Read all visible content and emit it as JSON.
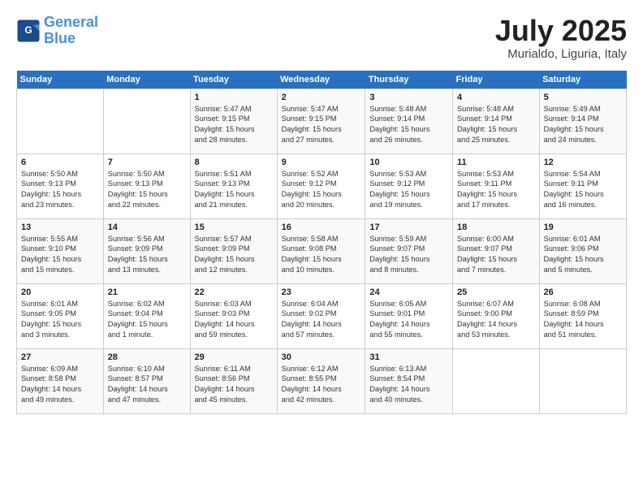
{
  "header": {
    "logo_line1": "General",
    "logo_line2": "Blue",
    "month": "July 2025",
    "location": "Murialdo, Liguria, Italy"
  },
  "weekdays": [
    "Sunday",
    "Monday",
    "Tuesday",
    "Wednesday",
    "Thursday",
    "Friday",
    "Saturday"
  ],
  "weeks": [
    [
      {
        "day": "",
        "info": ""
      },
      {
        "day": "",
        "info": ""
      },
      {
        "day": "1",
        "info": "Sunrise: 5:47 AM\nSunset: 9:15 PM\nDaylight: 15 hours\nand 28 minutes."
      },
      {
        "day": "2",
        "info": "Sunrise: 5:47 AM\nSunset: 9:15 PM\nDaylight: 15 hours\nand 27 minutes."
      },
      {
        "day": "3",
        "info": "Sunrise: 5:48 AM\nSunset: 9:14 PM\nDaylight: 15 hours\nand 26 minutes."
      },
      {
        "day": "4",
        "info": "Sunrise: 5:48 AM\nSunset: 9:14 PM\nDaylight: 15 hours\nand 25 minutes."
      },
      {
        "day": "5",
        "info": "Sunrise: 5:49 AM\nSunset: 9:14 PM\nDaylight: 15 hours\nand 24 minutes."
      }
    ],
    [
      {
        "day": "6",
        "info": "Sunrise: 5:50 AM\nSunset: 9:13 PM\nDaylight: 15 hours\nand 23 minutes."
      },
      {
        "day": "7",
        "info": "Sunrise: 5:50 AM\nSunset: 9:13 PM\nDaylight: 15 hours\nand 22 minutes."
      },
      {
        "day": "8",
        "info": "Sunrise: 5:51 AM\nSunset: 9:13 PM\nDaylight: 15 hours\nand 21 minutes."
      },
      {
        "day": "9",
        "info": "Sunrise: 5:52 AM\nSunset: 9:12 PM\nDaylight: 15 hours\nand 20 minutes."
      },
      {
        "day": "10",
        "info": "Sunrise: 5:53 AM\nSunset: 9:12 PM\nDaylight: 15 hours\nand 19 minutes."
      },
      {
        "day": "11",
        "info": "Sunrise: 5:53 AM\nSunset: 9:11 PM\nDaylight: 15 hours\nand 17 minutes."
      },
      {
        "day": "12",
        "info": "Sunrise: 5:54 AM\nSunset: 9:11 PM\nDaylight: 15 hours\nand 16 minutes."
      }
    ],
    [
      {
        "day": "13",
        "info": "Sunrise: 5:55 AM\nSunset: 9:10 PM\nDaylight: 15 hours\nand 15 minutes."
      },
      {
        "day": "14",
        "info": "Sunrise: 5:56 AM\nSunset: 9:09 PM\nDaylight: 15 hours\nand 13 minutes."
      },
      {
        "day": "15",
        "info": "Sunrise: 5:57 AM\nSunset: 9:09 PM\nDaylight: 15 hours\nand 12 minutes."
      },
      {
        "day": "16",
        "info": "Sunrise: 5:58 AM\nSunset: 9:08 PM\nDaylight: 15 hours\nand 10 minutes."
      },
      {
        "day": "17",
        "info": "Sunrise: 5:59 AM\nSunset: 9:07 PM\nDaylight: 15 hours\nand 8 minutes."
      },
      {
        "day": "18",
        "info": "Sunrise: 6:00 AM\nSunset: 9:07 PM\nDaylight: 15 hours\nand 7 minutes."
      },
      {
        "day": "19",
        "info": "Sunrise: 6:01 AM\nSunset: 9:06 PM\nDaylight: 15 hours\nand 5 minutes."
      }
    ],
    [
      {
        "day": "20",
        "info": "Sunrise: 6:01 AM\nSunset: 9:05 PM\nDaylight: 15 hours\nand 3 minutes."
      },
      {
        "day": "21",
        "info": "Sunrise: 6:02 AM\nSunset: 9:04 PM\nDaylight: 15 hours\nand 1 minute."
      },
      {
        "day": "22",
        "info": "Sunrise: 6:03 AM\nSunset: 9:03 PM\nDaylight: 14 hours\nand 59 minutes."
      },
      {
        "day": "23",
        "info": "Sunrise: 6:04 AM\nSunset: 9:02 PM\nDaylight: 14 hours\nand 57 minutes."
      },
      {
        "day": "24",
        "info": "Sunrise: 6:05 AM\nSunset: 9:01 PM\nDaylight: 14 hours\nand 55 minutes."
      },
      {
        "day": "25",
        "info": "Sunrise: 6:07 AM\nSunset: 9:00 PM\nDaylight: 14 hours\nand 53 minutes."
      },
      {
        "day": "26",
        "info": "Sunrise: 6:08 AM\nSunset: 8:59 PM\nDaylight: 14 hours\nand 51 minutes."
      }
    ],
    [
      {
        "day": "27",
        "info": "Sunrise: 6:09 AM\nSunset: 8:58 PM\nDaylight: 14 hours\nand 49 minutes."
      },
      {
        "day": "28",
        "info": "Sunrise: 6:10 AM\nSunset: 8:57 PM\nDaylight: 14 hours\nand 47 minutes."
      },
      {
        "day": "29",
        "info": "Sunrise: 6:11 AM\nSunset: 8:56 PM\nDaylight: 14 hours\nand 45 minutes."
      },
      {
        "day": "30",
        "info": "Sunrise: 6:12 AM\nSunset: 8:55 PM\nDaylight: 14 hours\nand 42 minutes."
      },
      {
        "day": "31",
        "info": "Sunrise: 6:13 AM\nSunset: 8:54 PM\nDaylight: 14 hours\nand 40 minutes."
      },
      {
        "day": "",
        "info": ""
      },
      {
        "day": "",
        "info": ""
      }
    ]
  ]
}
